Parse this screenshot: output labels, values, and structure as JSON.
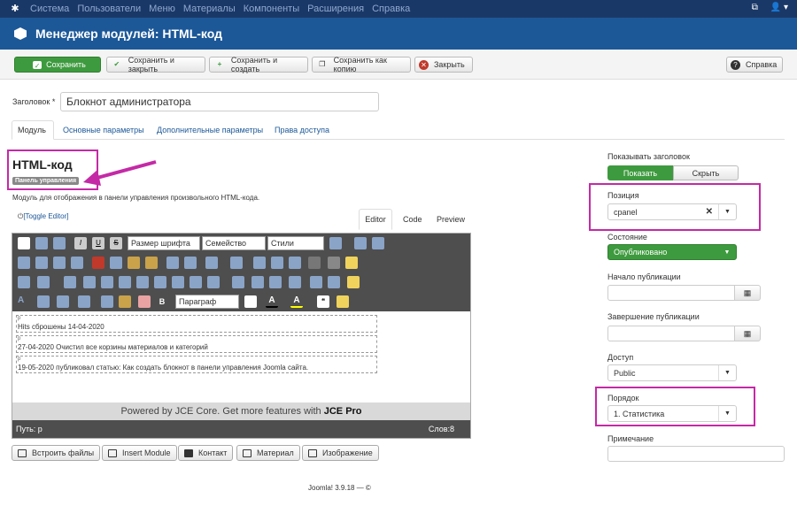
{
  "topbar": {
    "menu": [
      "Система",
      "Пользователи",
      "Меню",
      "Материалы",
      "Компоненты",
      "Расширения",
      "Справка"
    ]
  },
  "header": {
    "title": "Менеджер модулей: HTML-код"
  },
  "toolbar": {
    "save": "Сохранить",
    "save_close": "Сохранить и закрыть",
    "save_new": "Сохранить и создать",
    "save_copy": "Сохранить как копию",
    "close": "Закрыть",
    "help": "Справка"
  },
  "form": {
    "title_label": "Заголовок *",
    "title_value": "Блокнот администратора"
  },
  "tabs": [
    "Модуль",
    "Основные параметры",
    "Дополнительные параметры",
    "Права доступа"
  ],
  "module": {
    "name": "HTML-код",
    "badge": "Панель управления",
    "description": "Модуль для отображения в панели управления произвольного HTML-кода."
  },
  "editor": {
    "toggle": "[Toggle Editor]",
    "tabs": [
      "Editor",
      "Code",
      "Preview"
    ],
    "font_size": "Размер шрифта",
    "font_family": "Семейство",
    "styles": "Стили",
    "format": "Параграф",
    "paragraphs": [
      {
        "tag": "p",
        "text": "Hits сброшены 14-04-2020"
      },
      {
        "tag": "p",
        "text": "27-04-2020 Очистил все корзины материалов и категорий"
      },
      {
        "tag": "p",
        "text": "19-05-2020 публиковал статью: Как создать блокнот в панели управления Joomla сайта."
      }
    ],
    "powered": "Powered by JCE Core. Get more features with",
    "powered_bold": "JCE Pro",
    "path": "Путь: p",
    "words": "Слов:8"
  },
  "editor_buttons": [
    "Встроить файлы",
    "Insert Module",
    "Контакт",
    "Материал",
    "Изображение"
  ],
  "footer": "Joomla! 3.9.18 — ©",
  "sidebar": {
    "show_title_label": "Показывать заголовок",
    "show": "Показать",
    "hide": "Скрыть",
    "position_label": "Позиция",
    "position_value": "cpanel",
    "state_label": "Состояние",
    "state_value": "Опубликовано",
    "publish_up_label": "Начало публикации",
    "publish_down_label": "Завершение публикации",
    "access_label": "Доступ",
    "access_value": "Public",
    "order_label": "Порядок",
    "order_value": "1. Статистика",
    "note_label": "Примечание"
  },
  "colors": {
    "topbar": "#1a3867",
    "header": "#1c5898",
    "accent_green": "#3e9a3e",
    "highlight": "#c42aa6"
  }
}
